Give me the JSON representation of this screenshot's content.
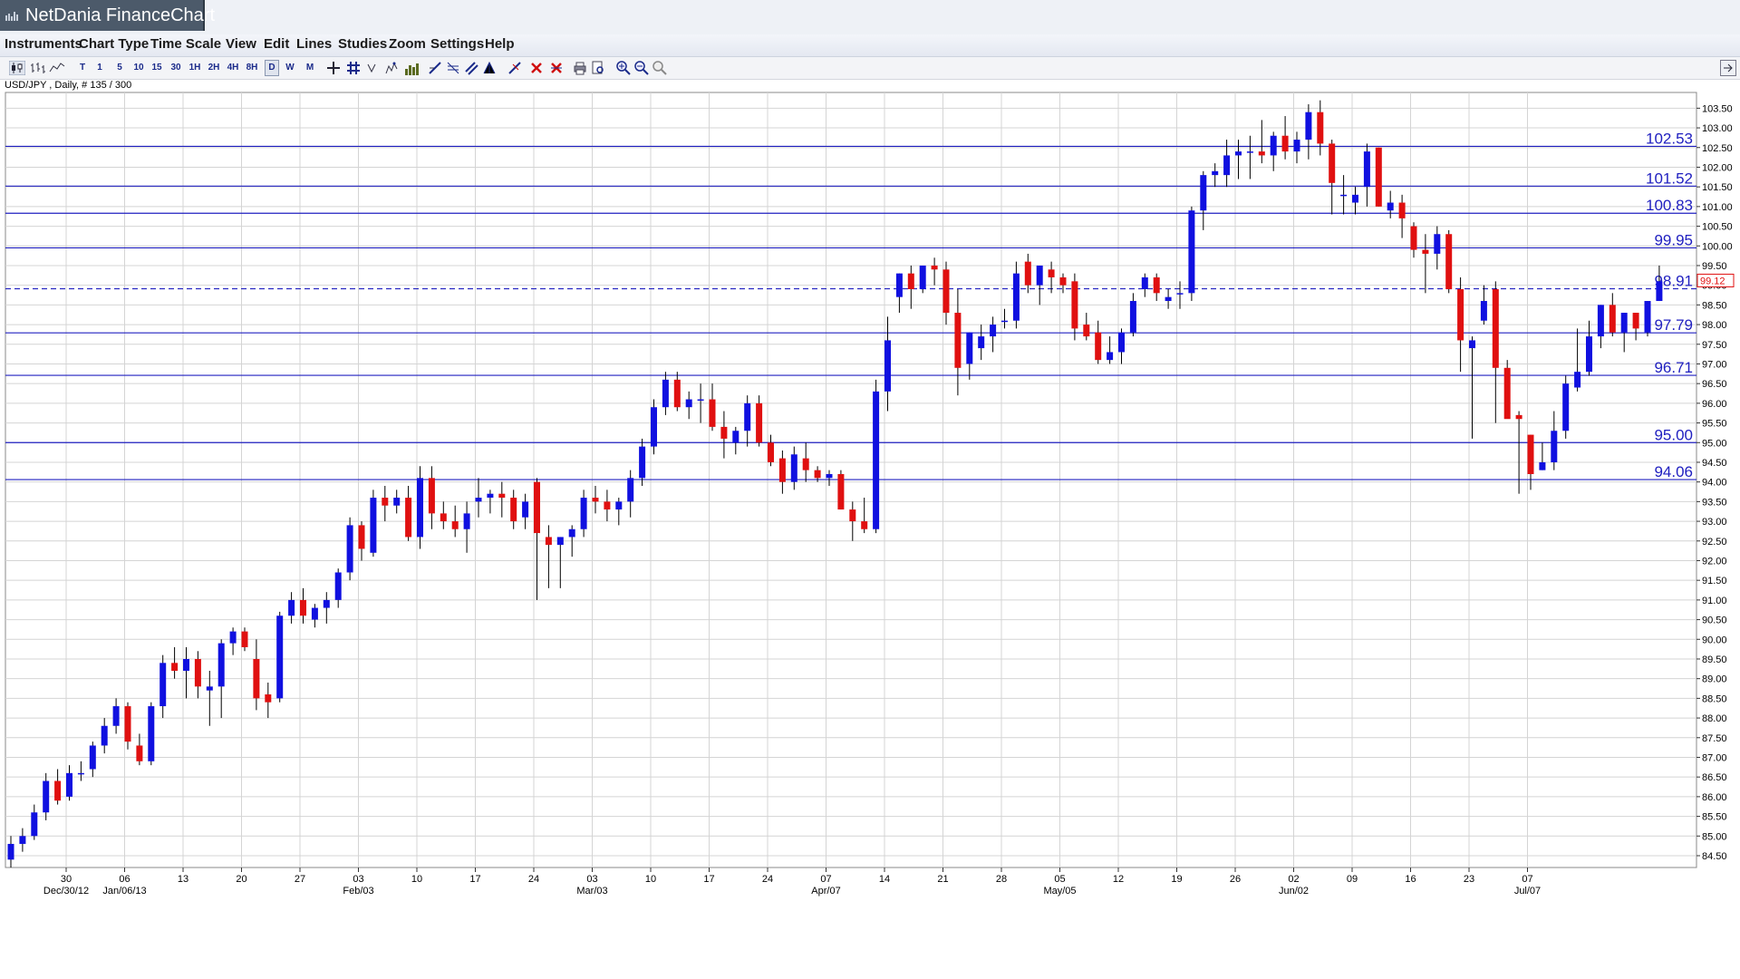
{
  "window": {
    "title": "NetDania FinanceChart"
  },
  "menu": [
    "Instruments",
    "Chart Type",
    "Time Scale",
    "View",
    "Edit",
    "Lines",
    "Studies",
    "Zoom",
    "Settings",
    "Help"
  ],
  "toolbar": {
    "timescales": [
      "T",
      "1",
      "5",
      "10",
      "15",
      "30",
      "1H",
      "2H",
      "4H",
      "8H",
      "D",
      "W",
      "M"
    ],
    "selected": "D",
    "icons": [
      "chart-type-candle-icon",
      "chart-type-bar-icon",
      "chart-type-line-icon",
      "crosshair-icon",
      "grid-icon",
      "cursor-icon",
      "study-icon",
      "volume-icon",
      "trendline-icon",
      "fibonacci-icon",
      "channel-icon",
      "pitchfork-icon",
      "draw-icon",
      "delete-icon",
      "delete-all-icon",
      "print-icon",
      "print-preview-icon",
      "zoom-in-icon",
      "zoom-out-icon",
      "zoom-reset-icon",
      "panel-toggle-icon"
    ]
  },
  "instrument_label": "USD/JPY , Daily, # 135 / 300",
  "chart_data": {
    "type": "candlestick",
    "instrument": "USD/JPY",
    "ylim": [
      84.2,
      103.9
    ],
    "y_ticks": [
      "84.50",
      "85.00",
      "85.50",
      "86.00",
      "86.50",
      "87.00",
      "87.50",
      "88.00",
      "88.50",
      "89.00",
      "89.50",
      "90.00",
      "90.50",
      "91.00",
      "91.50",
      "92.00",
      "92.50",
      "93.00",
      "93.50",
      "94.00",
      "94.50",
      "95.00",
      "95.50",
      "96.00",
      "96.50",
      "97.00",
      "97.50",
      "98.00",
      "98.50",
      "99.00",
      "99.50",
      "100.00",
      "100.50",
      "101.00",
      "101.50",
      "102.00",
      "102.50",
      "103.00",
      "103.50"
    ],
    "x_ticks": [
      {
        "day": "30",
        "month": "Dec/30/12"
      },
      {
        "day": "06",
        "month": "Jan/06/13"
      },
      {
        "day": "13",
        "month": ""
      },
      {
        "day": "20",
        "month": ""
      },
      {
        "day": "27",
        "month": ""
      },
      {
        "day": "03",
        "month": "Feb/03"
      },
      {
        "day": "10",
        "month": ""
      },
      {
        "day": "17",
        "month": ""
      },
      {
        "day": "24",
        "month": ""
      },
      {
        "day": "03",
        "month": "Mar/03"
      },
      {
        "day": "10",
        "month": ""
      },
      {
        "day": "17",
        "month": ""
      },
      {
        "day": "24",
        "month": ""
      },
      {
        "day": "07",
        "month": "Apr/07"
      },
      {
        "day": "14",
        "month": ""
      },
      {
        "day": "21",
        "month": ""
      },
      {
        "day": "28",
        "month": ""
      },
      {
        "day": "05",
        "month": "May/05"
      },
      {
        "day": "12",
        "month": ""
      },
      {
        "day": "19",
        "month": ""
      },
      {
        "day": "26",
        "month": ""
      },
      {
        "day": "02",
        "month": "Jun/02"
      },
      {
        "day": "09",
        "month": ""
      },
      {
        "day": "16",
        "month": ""
      },
      {
        "day": "23",
        "month": ""
      },
      {
        "day": "07",
        "month": "Jul/07"
      }
    ],
    "horizontal_levels": [
      "102.53",
      "101.52",
      "100.83",
      "99.95",
      "98.91",
      "97.79",
      "96.71",
      "95.00",
      "94.06"
    ],
    "dashed_level": "98.91",
    "current_price": "99.12",
    "colors": {
      "up": "#1010e0",
      "down": "#e01010",
      "level": "#2020c0",
      "grid": "#d4d4d4",
      "current": "#e01010"
    },
    "candles": [
      [
        84.4,
        85.0,
        84.2,
        84.8
      ],
      [
        84.8,
        85.2,
        84.6,
        85.0
      ],
      [
        85.0,
        85.8,
        84.9,
        85.6
      ],
      [
        85.6,
        86.6,
        85.4,
        86.4
      ],
      [
        86.4,
        86.7,
        85.8,
        85.9
      ],
      [
        86.0,
        86.8,
        85.9,
        86.6
      ],
      [
        86.6,
        86.9,
        86.4,
        86.6
      ],
      [
        86.7,
        87.4,
        86.5,
        87.3
      ],
      [
        87.3,
        88.0,
        87.1,
        87.8
      ],
      [
        87.8,
        88.5,
        87.6,
        88.3
      ],
      [
        88.3,
        88.4,
        87.2,
        87.4
      ],
      [
        87.3,
        87.6,
        86.8,
        86.9
      ],
      [
        86.9,
        88.4,
        86.8,
        88.3
      ],
      [
        88.3,
        89.6,
        88.0,
        89.4
      ],
      [
        89.4,
        89.8,
        89.0,
        89.2
      ],
      [
        89.2,
        89.8,
        88.5,
        89.5
      ],
      [
        89.5,
        89.7,
        88.5,
        88.8
      ],
      [
        88.7,
        89.2,
        87.8,
        88.8
      ],
      [
        88.8,
        90.0,
        88.0,
        89.9
      ],
      [
        89.9,
        90.3,
        89.6,
        90.2
      ],
      [
        90.2,
        90.3,
        89.7,
        89.8
      ],
      [
        89.5,
        90.0,
        88.2,
        88.5
      ],
      [
        88.6,
        88.9,
        88.0,
        88.4
      ],
      [
        88.5,
        90.7,
        88.4,
        90.6
      ],
      [
        90.6,
        91.2,
        90.4,
        91.0
      ],
      [
        91.0,
        91.3,
        90.4,
        90.6
      ],
      [
        90.5,
        90.9,
        90.3,
        90.8
      ],
      [
        90.8,
        91.2,
        90.4,
        91.0
      ],
      [
        91.0,
        91.8,
        90.8,
        91.7
      ],
      [
        91.7,
        93.1,
        91.5,
        92.9
      ],
      [
        92.9,
        93.0,
        92.0,
        92.3
      ],
      [
        92.2,
        93.8,
        92.1,
        93.6
      ],
      [
        93.6,
        93.9,
        93.0,
        93.4
      ],
      [
        93.4,
        93.8,
        93.2,
        93.6
      ],
      [
        93.6,
        93.9,
        92.5,
        92.6
      ],
      [
        92.6,
        94.4,
        92.3,
        94.1
      ],
      [
        94.1,
        94.4,
        92.8,
        93.2
      ],
      [
        93.2,
        93.5,
        92.8,
        93.0
      ],
      [
        93.0,
        93.4,
        92.6,
        92.8
      ],
      [
        92.8,
        93.5,
        92.2,
        93.2
      ],
      [
        93.5,
        94.1,
        93.1,
        93.6
      ],
      [
        93.6,
        93.8,
        93.2,
        93.7
      ],
      [
        93.7,
        94.0,
        93.1,
        93.6
      ],
      [
        93.6,
        93.8,
        92.8,
        93.0
      ],
      [
        93.1,
        93.7,
        92.8,
        93.5
      ],
      [
        94.0,
        94.1,
        91.0,
        92.7
      ],
      [
        92.6,
        92.9,
        91.3,
        92.4
      ],
      [
        92.4,
        92.6,
        91.3,
        92.6
      ],
      [
        92.6,
        92.9,
        92.1,
        92.8
      ],
      [
        92.8,
        93.8,
        92.6,
        93.6
      ],
      [
        93.6,
        93.9,
        93.2,
        93.5
      ],
      [
        93.5,
        93.8,
        93.0,
        93.3
      ],
      [
        93.3,
        93.6,
        92.9,
        93.5
      ],
      [
        93.5,
        94.3,
        93.1,
        94.1
      ],
      [
        94.1,
        95.1,
        93.9,
        94.9
      ],
      [
        94.9,
        96.1,
        94.7,
        95.9
      ],
      [
        95.9,
        96.8,
        95.7,
        96.6
      ],
      [
        96.6,
        96.8,
        95.8,
        95.9
      ],
      [
        95.9,
        96.3,
        95.6,
        96.1
      ],
      [
        96.1,
        96.5,
        95.5,
        96.1
      ],
      [
        96.1,
        96.5,
        95.3,
        95.4
      ],
      [
        95.4,
        95.8,
        94.6,
        95.1
      ],
      [
        95.0,
        95.4,
        94.7,
        95.3
      ],
      [
        95.3,
        96.2,
        94.9,
        96.0
      ],
      [
        96.0,
        96.2,
        94.9,
        95.0
      ],
      [
        95.0,
        95.2,
        94.4,
        94.5
      ],
      [
        94.6,
        94.8,
        93.7,
        94.0
      ],
      [
        94.0,
        94.9,
        93.8,
        94.7
      ],
      [
        94.6,
        95.0,
        94.0,
        94.3
      ],
      [
        94.3,
        94.4,
        94.0,
        94.1
      ],
      [
        94.1,
        94.3,
        93.9,
        94.2
      ],
      [
        94.2,
        94.3,
        93.3,
        93.3
      ],
      [
        93.3,
        93.5,
        92.5,
        93.0
      ],
      [
        93.0,
        93.6,
        92.7,
        92.8
      ],
      [
        92.8,
        96.6,
        92.7,
        96.3
      ],
      [
        96.3,
        98.2,
        95.8,
        97.6
      ],
      [
        98.7,
        99.3,
        98.3,
        99.3
      ],
      [
        99.3,
        99.5,
        98.4,
        98.9
      ],
      [
        98.9,
        99.5,
        98.8,
        99.5
      ],
      [
        99.5,
        99.7,
        99.0,
        99.4
      ],
      [
        99.4,
        99.6,
        98.0,
        98.3
      ],
      [
        98.3,
        98.9,
        96.2,
        96.9
      ],
      [
        97.0,
        97.8,
        96.6,
        97.8
      ],
      [
        97.4,
        98.0,
        97.1,
        97.7
      ],
      [
        97.7,
        98.2,
        97.3,
        98.0
      ],
      [
        98.1,
        98.4,
        97.9,
        98.1
      ],
      [
        98.1,
        99.6,
        97.9,
        99.3
      ],
      [
        99.6,
        99.8,
        98.8,
        99.0
      ],
      [
        99.0,
        99.4,
        98.5,
        99.5
      ],
      [
        99.4,
        99.6,
        98.8,
        99.2
      ],
      [
        99.2,
        99.3,
        98.8,
        99.0
      ],
      [
        99.1,
        99.3,
        97.6,
        97.9
      ],
      [
        98.0,
        98.3,
        97.6,
        97.7
      ],
      [
        97.8,
        98.1,
        97.0,
        97.1
      ],
      [
        97.1,
        97.7,
        97.0,
        97.3
      ],
      [
        97.3,
        97.9,
        97.0,
        97.8
      ],
      [
        97.8,
        98.8,
        97.7,
        98.6
      ],
      [
        98.9,
        99.3,
        98.7,
        99.2
      ],
      [
        99.2,
        99.3,
        98.6,
        98.8
      ],
      [
        98.6,
        98.9,
        98.4,
        98.7
      ],
      [
        98.8,
        99.1,
        98.4,
        98.8
      ],
      [
        98.8,
        101.0,
        98.6,
        100.9
      ],
      [
        100.9,
        101.9,
        100.4,
        101.8
      ],
      [
        101.8,
        102.1,
        101.5,
        101.9
      ],
      [
        101.8,
        102.7,
        101.5,
        102.3
      ],
      [
        102.3,
        102.7,
        101.7,
        102.4
      ],
      [
        102.4,
        102.8,
        101.7,
        102.4
      ],
      [
        102.4,
        103.2,
        102.1,
        102.3
      ],
      [
        102.3,
        102.9,
        101.9,
        102.8
      ],
      [
        102.8,
        103.3,
        102.2,
        102.4
      ],
      [
        102.4,
        102.9,
        102.1,
        102.7
      ],
      [
        102.7,
        103.6,
        102.2,
        103.4
      ],
      [
        103.4,
        103.7,
        102.3,
        102.6
      ],
      [
        102.6,
        102.7,
        100.8,
        101.6
      ],
      [
        101.3,
        101.8,
        100.8,
        101.3
      ],
      [
        101.1,
        101.5,
        100.8,
        101.3
      ],
      [
        101.5,
        102.6,
        101.0,
        102.4
      ],
      [
        102.5,
        102.5,
        101.0,
        101.0
      ],
      [
        100.9,
        101.4,
        100.7,
        101.1
      ],
      [
        101.1,
        101.3,
        100.2,
        100.7
      ],
      [
        100.5,
        100.6,
        99.7,
        99.9
      ],
      [
        99.9,
        100.3,
        98.8,
        99.8
      ],
      [
        99.8,
        100.5,
        99.4,
        100.3
      ],
      [
        100.3,
        100.4,
        98.8,
        98.9
      ],
      [
        98.9,
        99.2,
        96.8,
        97.6
      ],
      [
        97.4,
        97.7,
        95.1,
        97.6
      ],
      [
        98.1,
        99.0,
        98.0,
        98.6
      ],
      [
        98.9,
        99.1,
        95.5,
        96.9
      ],
      [
        96.9,
        97.1,
        95.9,
        95.6
      ],
      [
        95.7,
        95.8,
        93.7,
        95.6
      ],
      [
        95.2,
        95.2,
        93.8,
        94.2
      ],
      [
        94.3,
        95.0,
        94.3,
        94.5
      ],
      [
        94.5,
        95.8,
        94.3,
        95.3
      ],
      [
        95.3,
        96.7,
        95.1,
        96.5
      ],
      [
        96.4,
        97.9,
        96.3,
        96.8
      ],
      [
        96.8,
        98.1,
        96.7,
        97.7
      ],
      [
        97.7,
        98.5,
        97.4,
        98.5
      ],
      [
        98.5,
        98.8,
        97.7,
        97.8
      ],
      [
        97.8,
        98.3,
        97.3,
        98.3
      ],
      [
        98.3,
        98.3,
        97.6,
        97.9
      ],
      [
        97.8,
        98.6,
        97.7,
        98.6
      ],
      [
        98.6,
        99.5,
        98.6,
        99.1
      ]
    ]
  }
}
